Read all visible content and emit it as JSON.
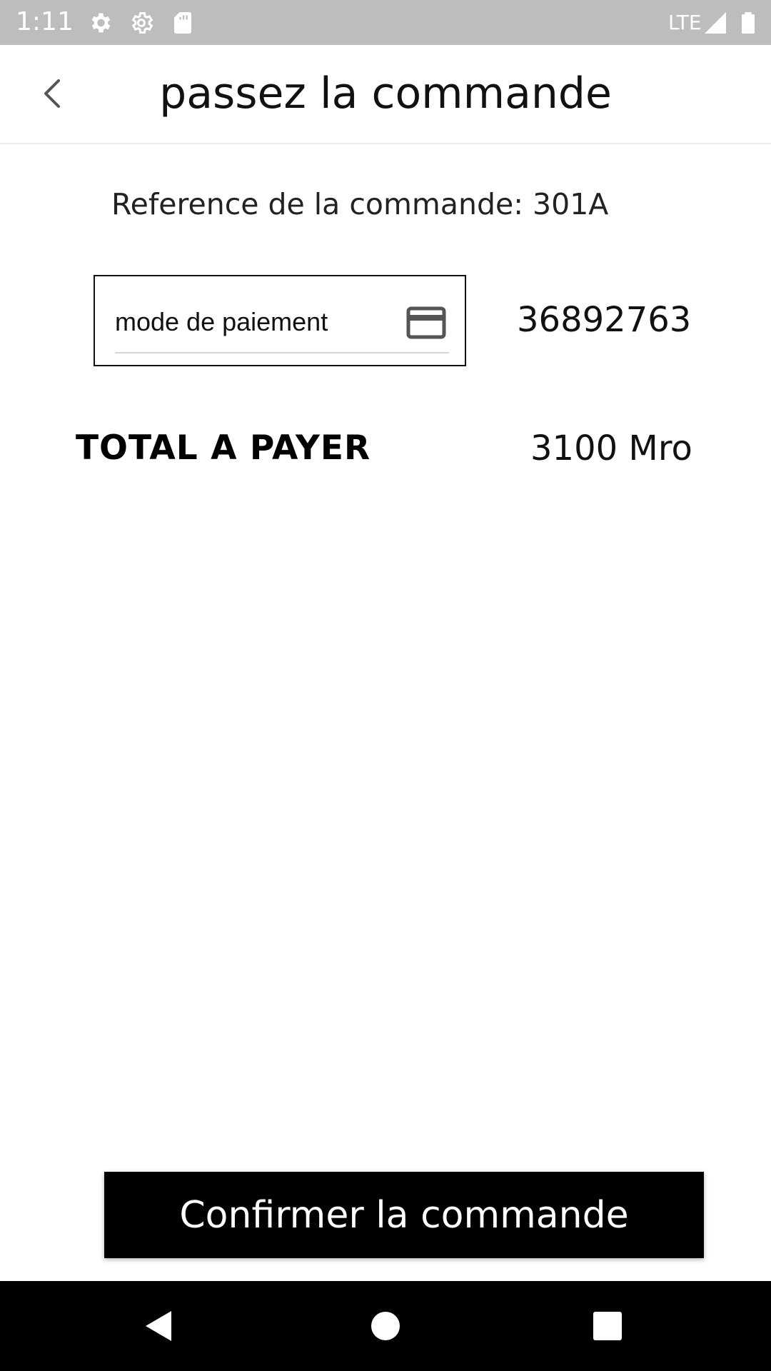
{
  "status_bar": {
    "time": "1:11",
    "network": "LTE",
    "icons": [
      "settings-icon",
      "settings-outline-icon",
      "sd-card-icon",
      "signal-icon",
      "battery-icon"
    ]
  },
  "header": {
    "title": "passez la commande",
    "back_icon": "chevron-left-icon"
  },
  "order": {
    "reference": "Reference de la commande: 301A",
    "payment_method_label": "mode de paiement",
    "payment_method_icon": "credit-card-icon",
    "payment_number": "36892763",
    "total_label": "TOTAL A PAYER",
    "total_value": "3100 Mro"
  },
  "actions": {
    "confirm_label": "Confirmer la commande"
  },
  "nav_bar": {
    "icons": [
      "back-triangle-icon",
      "home-circle-icon",
      "recents-square-icon"
    ]
  },
  "colors": {
    "status_bar_bg": "#bdbdbd",
    "primary": "#000000",
    "background": "#ffffff"
  }
}
